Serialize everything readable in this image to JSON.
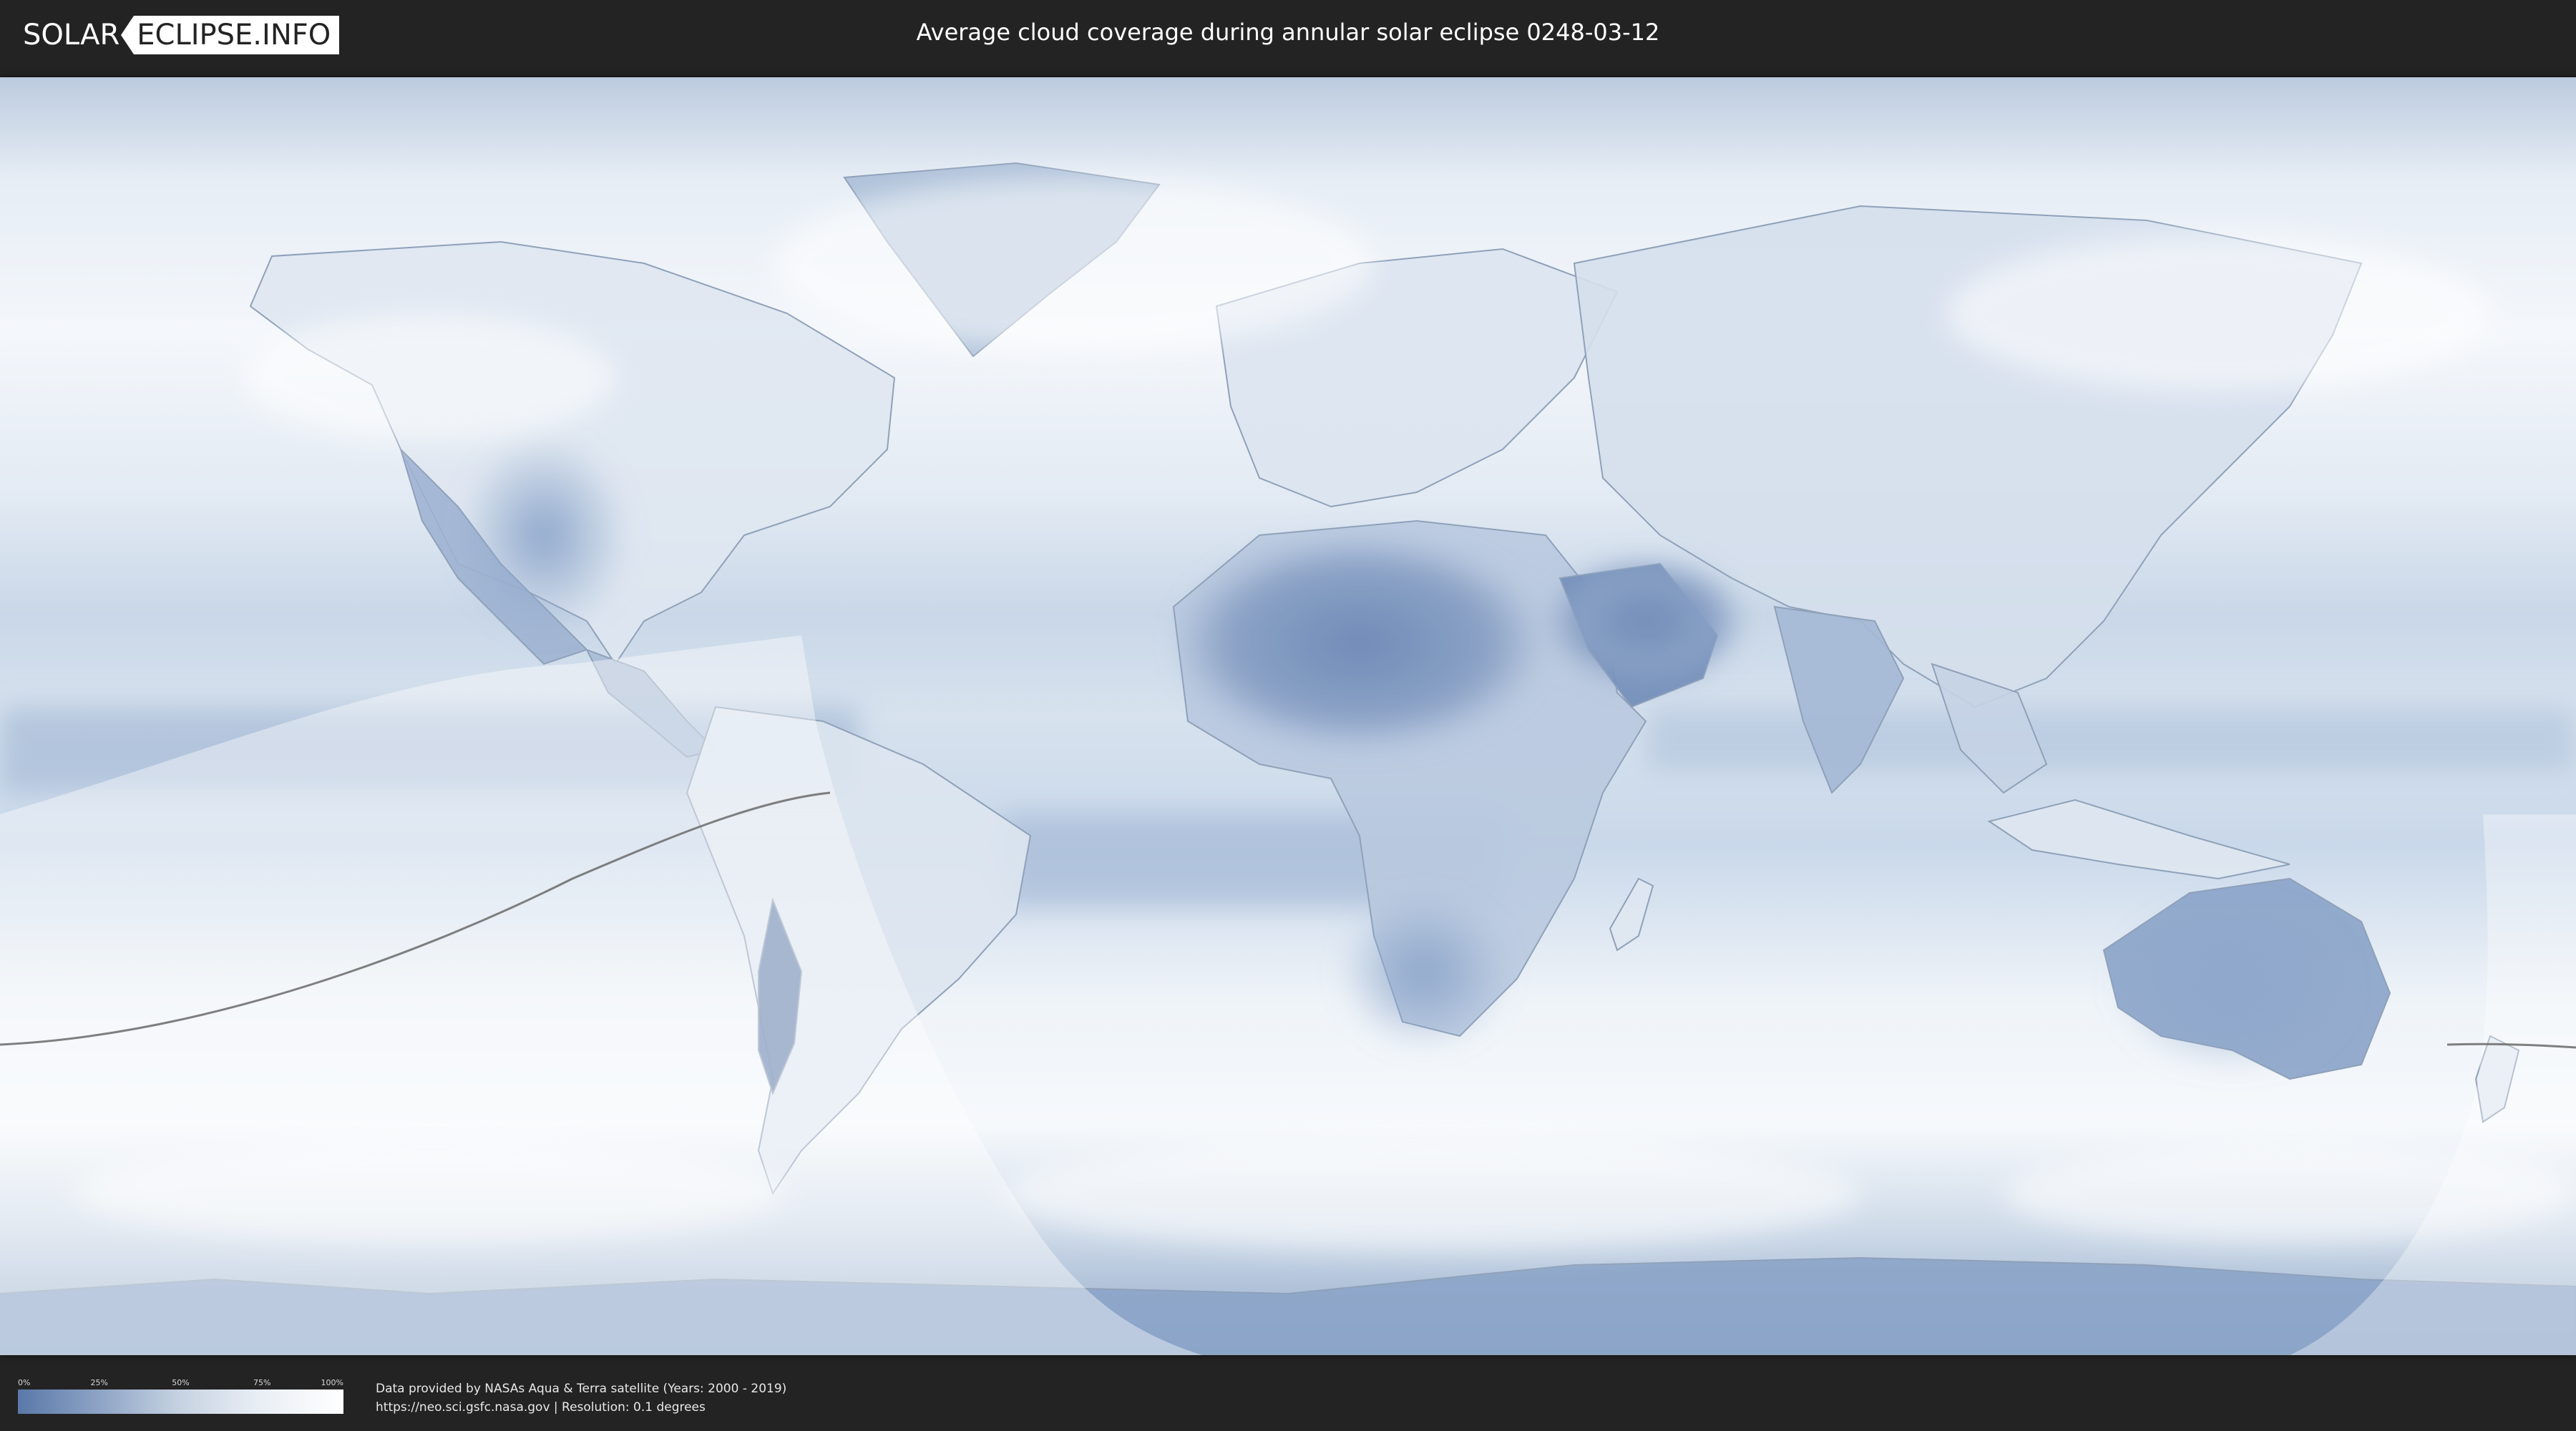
{
  "header": {
    "logo_left": "SOLAR",
    "logo_right": "ECLIPSE.INFO",
    "title": "Average cloud coverage during annular solar eclipse 0248-03-12"
  },
  "map": {
    "description_layer": "cloud-coverage",
    "colors": {
      "low_cloud": "#5a78a8",
      "mid_cloud": "#a9bcd6",
      "high_cloud": "#ffffff",
      "penumbra_overlay": "#ffffff",
      "eclipse_path": "#6a6a6a"
    }
  },
  "legend": {
    "ticks": [
      "0%",
      "25%",
      "50%",
      "75%",
      "100%"
    ],
    "colors": [
      "#5a78a8",
      "#8ea4c6",
      "#c7d3e2",
      "#eaeff5",
      "#ffffff"
    ]
  },
  "credits": {
    "line1": "Data provided by NASAs Aqua & Terra satellite (Years: 2000 - 2019)",
    "line2": "https://neo.sci.gsfc.nasa.gov | Resolution: 0.1 degrees"
  }
}
